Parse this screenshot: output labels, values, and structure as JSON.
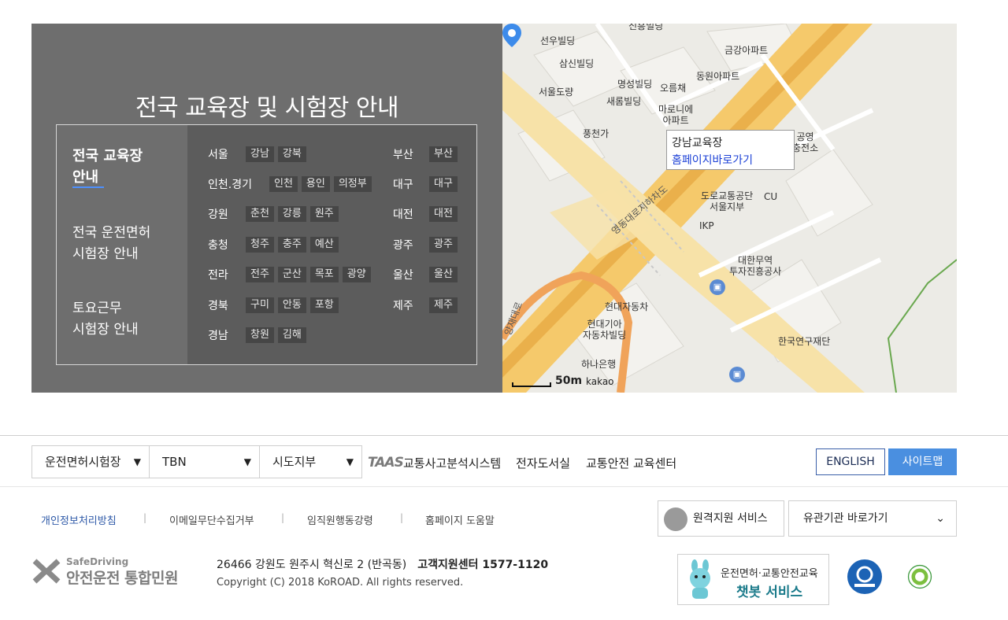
{
  "guide": {
    "title": "전국 교육장 및 시험장 안내",
    "menu": [
      {
        "line1": "전국 교육장",
        "line2": "안내"
      },
      {
        "line1": "전국 운전면허",
        "line2": "시험장 안내"
      },
      {
        "line1": "토요근무",
        "line2": "시험장 안내"
      }
    ],
    "regions_left": [
      {
        "name": "서울",
        "tags": [
          "강남",
          "강북"
        ]
      },
      {
        "name": "인천.경기",
        "tags": [
          "인천",
          "용인",
          "의정부"
        ]
      },
      {
        "name": "강원",
        "tags": [
          "춘천",
          "강릉",
          "원주"
        ]
      },
      {
        "name": "충청",
        "tags": [
          "청주",
          "충주",
          "예산"
        ]
      },
      {
        "name": "전라",
        "tags": [
          "전주",
          "군산",
          "목포",
          "광양"
        ]
      },
      {
        "name": "경북",
        "tags": [
          "구미",
          "안동",
          "포항"
        ]
      },
      {
        "name": "경남",
        "tags": [
          "창원",
          "김해"
        ]
      }
    ],
    "regions_right": [
      {
        "name": "부산",
        "tags": [
          "부산"
        ]
      },
      {
        "name": "대구",
        "tags": [
          "대구"
        ]
      },
      {
        "name": "대전",
        "tags": [
          "대전"
        ]
      },
      {
        "name": "광주",
        "tags": [
          "광주"
        ]
      },
      {
        "name": "울산",
        "tags": [
          "울산"
        ]
      },
      {
        "name": "제주",
        "tags": [
          "제주"
        ]
      }
    ]
  },
  "map": {
    "callout_title": "강남교육장",
    "callout_link": "홈페이지바로가기",
    "labels": {
      "l1": "선우빌딩",
      "l2": "삼신빌딩",
      "l3": "서울도량",
      "l4": "명성빌딩",
      "l5": "오름채",
      "l6": "새롬빌딩",
      "l7": "마로니에",
      "l7b": "아파트",
      "l8": "풍천가",
      "l9": "금강아파트",
      "l10": "동원아파트",
      "l11": "도로교통공단",
      "l11b": "서울지부",
      "l12": "CU",
      "l13": "IKP",
      "l14": "대한무역",
      "l14b": "투자진흥공사",
      "l15": "현대자동차",
      "l16": "현대기아",
      "l16b": "자동차빌딩",
      "l17": "하나은행",
      "l18": "한국연구재단",
      "l19": "신흥빌딩",
      "l20": "영동대로지하차도",
      "l21": "공영",
      "l21b": "충전소",
      "l22": "양재대로"
    },
    "scale": "50m",
    "attribution": "kakao"
  },
  "footer": {
    "selects": [
      "운전면허시험장",
      "TBN",
      "시도지부"
    ],
    "taas": "TAAS",
    "links": [
      "교통사고분석시스템",
      "전자도서실",
      "교통안전 교육센터"
    ],
    "english": "ENGLISH",
    "sitemap": "사이트맵",
    "policy_links": [
      "개인정보처리방침",
      "이메일무단수집거부",
      "임직원행동강령",
      "홈페이지 도움말"
    ],
    "remote": "원격지원 서비스",
    "org_select": "유관기관 바로가기",
    "brand_small": "SafeDriving",
    "brand_big": "안전운전 통합민원",
    "address": "26466 강원도 원주시 혁신로 2 (반곡동)",
    "callcenter": "고객지원센터 1577-1120",
    "copyright": "Copyright (C) 2018 KoROAD. All rights reserved.",
    "chatbot_l1": "운전면허·교통안전교육",
    "chatbot_l2": "챗봇 서비스"
  }
}
